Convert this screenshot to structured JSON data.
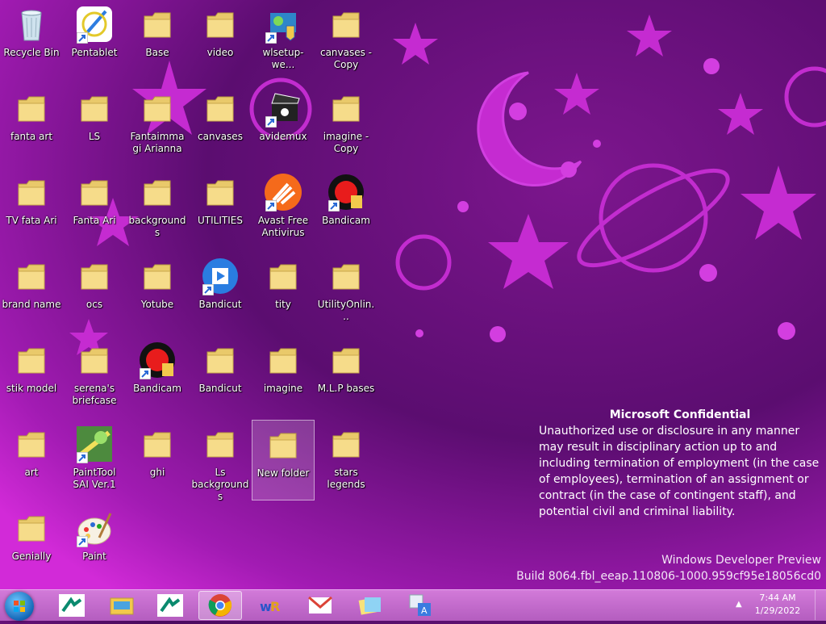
{
  "desktop": {
    "icons": [
      {
        "label": "Recycle Bin",
        "type": "bin"
      },
      {
        "label": "Pentablet",
        "type": "app-pentablet"
      },
      {
        "label": "Base",
        "type": "folder"
      },
      {
        "label": "video",
        "type": "folder"
      },
      {
        "label": "wlsetup-we...",
        "type": "app-wlsetup"
      },
      {
        "label": "canvases - Copy",
        "type": "folder"
      },
      {
        "label": "fanta art",
        "type": "folder"
      },
      {
        "label": "LS",
        "type": "folder"
      },
      {
        "label": "Fantaimmagi Arianna",
        "type": "folder"
      },
      {
        "label": "canvases",
        "type": "folder"
      },
      {
        "label": "avidemux",
        "type": "app-avidemux"
      },
      {
        "label": "imagine - Copy",
        "type": "folder"
      },
      {
        "label": "TV fata Ari",
        "type": "folder"
      },
      {
        "label": "Fanta Ari",
        "type": "folder"
      },
      {
        "label": "backgrounds",
        "type": "folder"
      },
      {
        "label": "UTILITIES",
        "type": "folder"
      },
      {
        "label": "Avast Free Antivirus",
        "type": "app-avast"
      },
      {
        "label": "Bandicam",
        "type": "app-bandicam"
      },
      {
        "label": "brand name",
        "type": "folder"
      },
      {
        "label": "ocs",
        "type": "folder"
      },
      {
        "label": "Yotube",
        "type": "folder"
      },
      {
        "label": "Bandicut",
        "type": "app-bandicut"
      },
      {
        "label": "tity",
        "type": "folder"
      },
      {
        "label": "UtilityOnlin...",
        "type": "folder"
      },
      {
        "label": "stik model",
        "type": "folder"
      },
      {
        "label": "serena's briefcase",
        "type": "folder"
      },
      {
        "label": "Bandicam",
        "type": "app-bandicam"
      },
      {
        "label": "Bandicut",
        "type": "folder"
      },
      {
        "label": "imagine",
        "type": "folder"
      },
      {
        "label": "M.L.P bases",
        "type": "folder"
      },
      {
        "label": "art",
        "type": "folder"
      },
      {
        "label": "PaintTool SAI Ver.1",
        "type": "app-sai"
      },
      {
        "label": "ghi",
        "type": "folder"
      },
      {
        "label": "Ls backgrounds",
        "type": "folder"
      },
      {
        "label": "New folder",
        "type": "folder"
      },
      {
        "label": "stars legends",
        "type": "folder"
      },
      {
        "label": "Genially",
        "type": "folder"
      },
      {
        "label": "Paint",
        "type": "app-paint"
      }
    ]
  },
  "notice": {
    "title": "Microsoft Confidential",
    "body": "Unauthorized use or disclosure in any manner may result in disciplinary action up to and including termination of employment (in the case of employees), termination of an assignment or contract (in the case of contingent staff), and potential civil and criminal liability."
  },
  "build": {
    "line1": "Windows Developer Preview",
    "line2": "Build 8064.fbl_eeap.110806-1000.959cf95e18056cd0"
  },
  "taskbar": {
    "items": [
      {
        "icon": "credit-agricole-icon"
      },
      {
        "icon": "file-explorer-icon"
      },
      {
        "icon": "credit-agricole-icon"
      },
      {
        "icon": "chrome-icon",
        "active": true
      },
      {
        "icon": "wordreference-icon"
      },
      {
        "icon": "gmail-icon"
      },
      {
        "icon": "sticky-notes-icon"
      },
      {
        "icon": "translate-icon"
      }
    ],
    "time": "7:44 AM",
    "date": "1/29/2022"
  },
  "colors": {
    "accent": "#c23ad1",
    "taskbar": "#c46ace",
    "wallpaper": "#5a0f6e"
  }
}
